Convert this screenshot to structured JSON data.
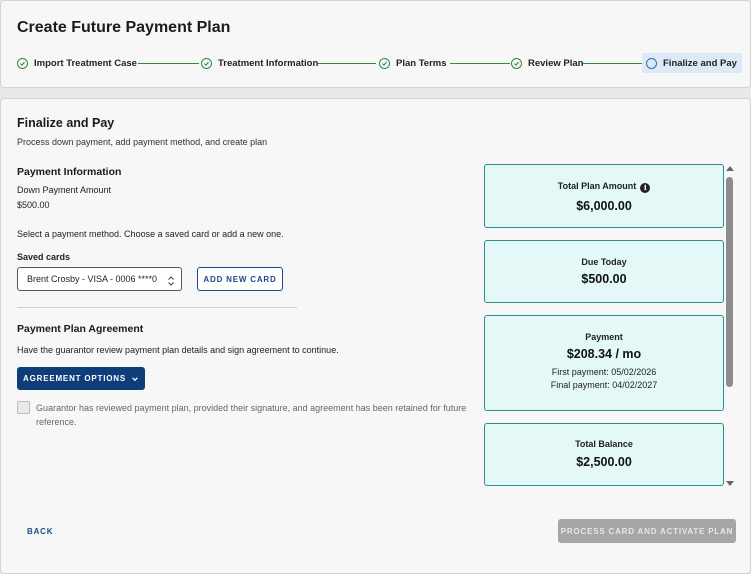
{
  "page_title": "Create Future Payment Plan",
  "stepper": {
    "steps": [
      {
        "label": "Import Treatment Case",
        "status": "complete"
      },
      {
        "label": "Treatment Information",
        "status": "complete"
      },
      {
        "label": "Plan Terms",
        "status": "complete"
      },
      {
        "label": "Review Plan",
        "status": "complete"
      },
      {
        "label": "Finalize and Pay",
        "status": "current"
      }
    ]
  },
  "section": {
    "title": "Finalize and Pay",
    "subtitle": "Process down payment, add payment method, and create plan"
  },
  "payment_information": {
    "title": "Payment Information",
    "down_payment_label": "Down Payment Amount",
    "down_payment_value": "$500.00",
    "instruction": "Select a payment method. Choose a saved card or add a new one.",
    "saved_cards_label": "Saved cards",
    "saved_card_selected": "Brent Crosby - VISA - 0006 ****0",
    "add_card_label": "ADD NEW CARD"
  },
  "agreement": {
    "title": "Payment Plan Agreement",
    "text": "Have the guarantor review payment plan details and sign agreement to continue.",
    "options_label": "AGREEMENT OPTIONS",
    "checkbox_text": "Guarantor has reviewed payment plan, provided their signature, and agreement has been retained for future reference.",
    "checkbox_checked": false
  },
  "summary": {
    "total_plan": {
      "label": "Total Plan Amount",
      "value": "$6,000.00"
    },
    "due_today": {
      "label": "Due Today",
      "value": "$500.00"
    },
    "payment": {
      "label": "Payment",
      "value": "$208.34 / mo",
      "first_payment": "First payment: 05/02/2026",
      "final_payment": "Final payment: 04/02/2027"
    },
    "total_balance": {
      "label": "Total Balance",
      "value": "$2,500.00"
    }
  },
  "footer": {
    "back_label": "BACK",
    "process_label": "PROCESS CARD AND ACTIVATE PLAN"
  },
  "colors": {
    "primary": "#0f3d7a",
    "success": "#2e8b3f",
    "summary_bg": "#e3f8f7",
    "summary_border": "#2a8f8c",
    "disabled": "#a6a6a6"
  },
  "icons": {
    "step_complete": "check-circle-icon",
    "step_current": "circle-icon",
    "info": "info-icon",
    "dropdown": "chevron-down-icon",
    "select": "up-down-chevron-icon"
  }
}
